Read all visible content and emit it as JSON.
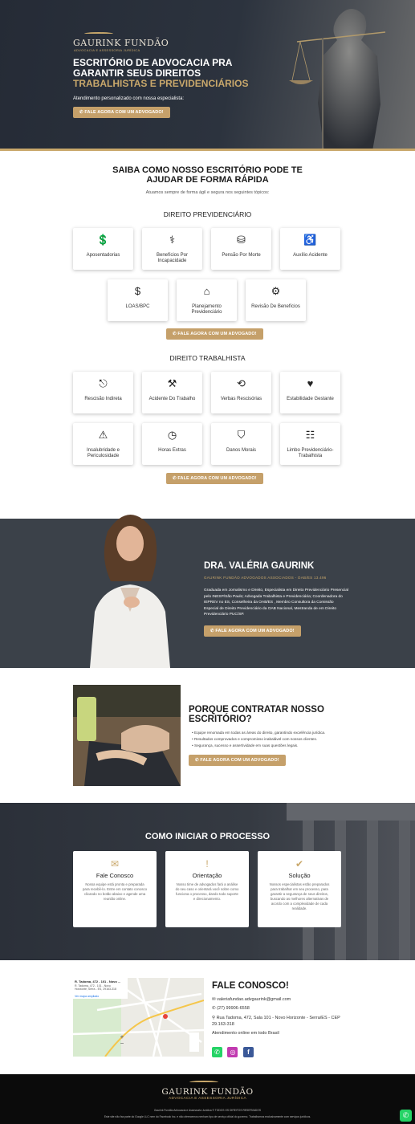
{
  "hero": {
    "logo_name": "GAURINK FUNDÃO",
    "logo_sub": "ADVOCACIA E ASSESSORIA JURÍDICA",
    "title_line1": "ESCRITÓRIO DE ADVOCACIA PRA",
    "title_line2": "GARANTIR SEUS DIREITOS",
    "title_line3": "TRABALHISTAS E PREVIDENCIÁRIOS",
    "subtitle": "Atendimento personalizado com nossa especialista:",
    "cta": "FALE AGORA COM UM ADVOGADO!"
  },
  "services": {
    "title_line1": "SAIBA COMO NOSSO ESCRITÓRIO PODE TE",
    "title_line2": "AJUDAR DE FORMA RÁPIDA",
    "subtitle": "Atuamos sempre de forma ágil e segura nos seguintes tópicos:",
    "prev_title": "DIREITO PREVIDENCIÁRIO",
    "prev_items": [
      {
        "label": "Aposentadorias",
        "icon": "money-hand-icon"
      },
      {
        "label": "Benefícios Por Incapacidade",
        "icon": "medical-bag-icon"
      },
      {
        "label": "Pensão Por Morte",
        "icon": "coins-icon"
      },
      {
        "label": "Auxílio Acidente",
        "icon": "injured-person-icon"
      },
      {
        "label": "LOAS/BPC",
        "icon": "piggy-bank-icon"
      },
      {
        "label": "Planejamento Previdenciário",
        "icon": "house-money-icon"
      },
      {
        "label": "Revisão De Benefícios",
        "icon": "gear-money-icon"
      }
    ],
    "cta1": "FALE AGORA COM UM ADVOGADO!",
    "trab_title": "DIREITO TRABALHISTA",
    "trab_items": [
      {
        "label": "Rescisão Indireta",
        "icon": "exit-door-icon"
      },
      {
        "label": "Acidente Do Trabalho",
        "icon": "worker-accident-icon"
      },
      {
        "label": "Verbas Rescisórias",
        "icon": "refund-icon"
      },
      {
        "label": "Estabilidade Gestante",
        "icon": "pregnant-heart-icon"
      },
      {
        "label": "Insalubridade e Periculosidade",
        "icon": "warning-icon"
      },
      {
        "label": "Horas Extras",
        "icon": "clock-icon"
      },
      {
        "label": "Danos Morais",
        "icon": "shield-icon"
      },
      {
        "label": "Limbo Previdenciário-Trabalhista",
        "icon": "id-card-icon"
      }
    ],
    "cta2": "FALE AGORA COM UM ADVOGADO!"
  },
  "doctor": {
    "name": "DRA. VALÉRIA GAURINK",
    "firm": "GAURINK FUNDÃO ADVOGADOS ASSOCIADOS - OAB/ES 13.496",
    "bio": "Graduada em Jornalismo e Direito, Especialista em Direito Previdenciário Presencial pelo INESP/São Paulo; Advogada Trabalhista e Previdenciária; Coordenadora do IEPREV no ES, Conselheira da OAB/ES , Membro Consultora da Comissão Especial de Direito Previdenciário da OAB Nacional, Mestranda de em Direito Previdenciário PUC/SP.",
    "cta": "FALE AGORA COM UM ADVOGADO!"
  },
  "why": {
    "title_line1": "PORQUE CONTRATAR NOSSO",
    "title_line2": "ESCRITÓRIO?",
    "bullets": [
      "Equipe renomada em todas as áreas do direito, garantindo excelência jurídica.",
      "Resultados comprovados e compromisso inabalável com nossos clientes.",
      "Segurança, sucesso e assertividade em suas questões legais."
    ],
    "cta": "FALE AGORA COM UM ADVOGADO!"
  },
  "process": {
    "title": "COMO INICIAR O PROCESSO",
    "steps": [
      {
        "title": "Fale Conosco",
        "icon": "chat-icon",
        "desc": "Nossa equipe está pronta e preparada para recebê-lo. Entre em contato conosco clicando no botão abaixo e agende uma reunião online."
      },
      {
        "title": "Orientação",
        "icon": "exclamation-icon",
        "desc": "Nosso time de advogados fará a análise do seu caso e orientará você sobre como funciona o processo, dando todo suporte e direcionamento."
      },
      {
        "title": "Solução",
        "icon": "double-check-icon",
        "desc": "Nossos especialistas estão preparados para trabalhar em seu processo, para garantir a segurança de seus direitos, buscando as melhores alternativas de acordo com a complexidade de cada realidade."
      }
    ]
  },
  "contact": {
    "title": "FALE CONOSCO!",
    "email": "valeriafundao.advgaurink@gmail.com",
    "phone": "(27) 99906-6558",
    "address": "Rua Tadoma, 472, Sala 101 - Novo Horizonte - Serra/ES - CEP 29.163-318",
    "online": "Atendimento online em todo Brasil",
    "map_title": "R. Tadoma, 472 - 101 - Novo ...",
    "map_addr": "R. Tadoma, 472 - 101 - Novo Horizonte, Serra - ES, 29163-318",
    "map_link": "Ver mapa ampliado"
  },
  "footer": {
    "logo_name": "GAURINK FUNDÃO",
    "logo_sub": "ADVOCACIA E ASSESSORIA JURÍDICA",
    "copy": "Gaurink Fundão Advocacia e Assessoria Jurídica © TODOS OS DIREITOS RESERVADOS",
    "disclaimer": "Este site não faz parte do Google LLC nem do Facebook Inc. e não oferecemos nenhum tipo de serviço oficial do governo. Trabalhamos exclusivamente com serviços jurídicos."
  },
  "colors": {
    "gold": "#c9a86b",
    "dark": "#2c333e",
    "whatsapp": "#25d366"
  }
}
